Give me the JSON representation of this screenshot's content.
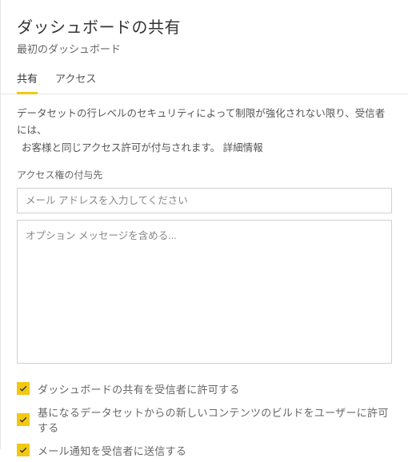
{
  "header": {
    "title": "ダッシュボードの共有",
    "subtitle": "最初のダッシュボード"
  },
  "tabs": {
    "share": "共有",
    "access": "アクセス"
  },
  "info": {
    "line1": "データセットの行レベルのセキュリティによって制限が強化されない限り、受信者には、",
    "line2_prefix": "お客様と同じアクセス許可が付与されます。",
    "learn_more": "詳細情報"
  },
  "recipients": {
    "label": "アクセス権の付与先",
    "placeholder": "メール アドレスを入力してください"
  },
  "message": {
    "placeholder": "オプション メッセージを含める..."
  },
  "options": {
    "allow_reshare": "ダッシュボードの共有を受信者に許可する",
    "allow_build": "基になるデータセットからの新しいコンテンツのビルドをユーザーに許可する",
    "send_notification": "メール通知を受信者に送信する"
  }
}
